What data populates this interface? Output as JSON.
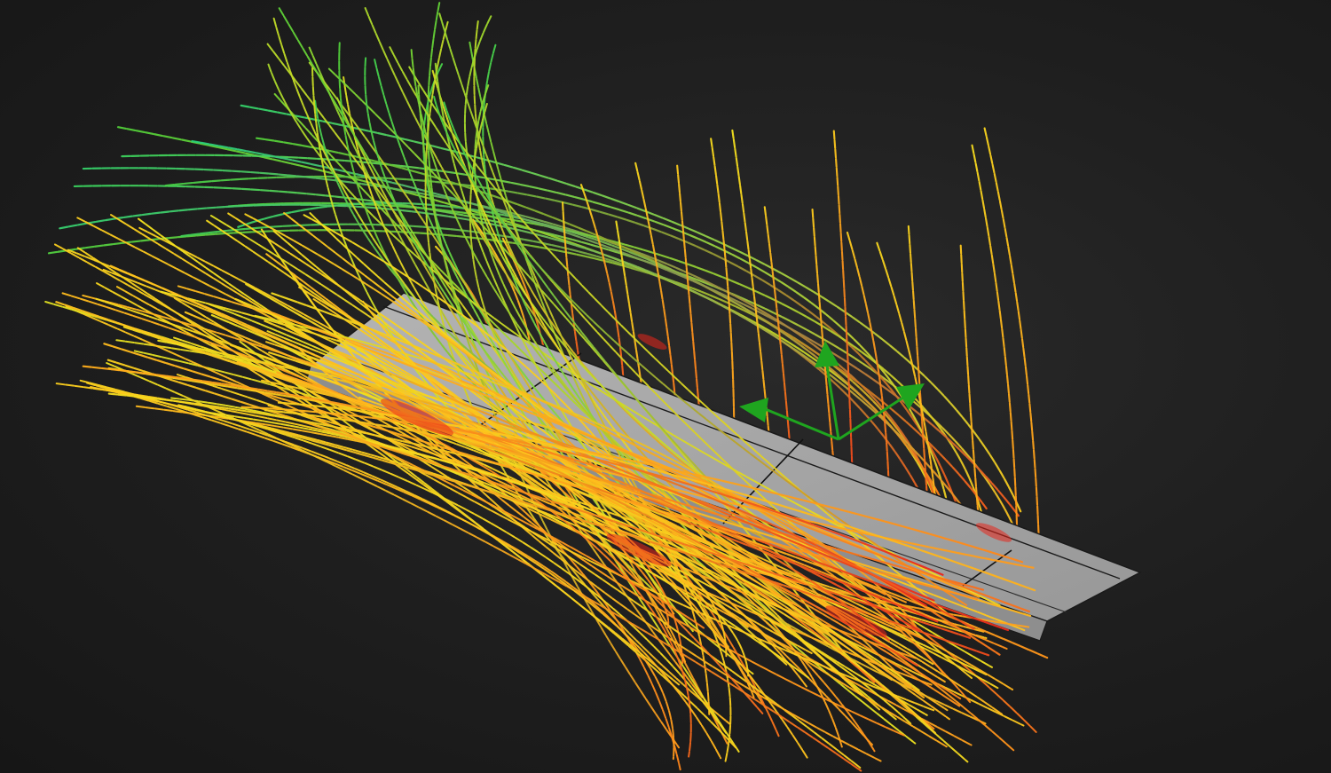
{
  "scene": {
    "background_color": "#1e1e1e",
    "plate_color": "#a8a8a8",
    "plate_edge_color": "#101010",
    "axis_triad_color": "#1fa51f",
    "streamline_color_scale": [
      "#2ad07a",
      "#4ccf3a",
      "#a8d82a",
      "#f2e21e",
      "#ffc31c",
      "#ff8a1a",
      "#e8261c"
    ],
    "streamline_families": {
      "green_arcs": 13,
      "upper_fan": 34,
      "vertical_lines": 19,
      "lower_fan": 65,
      "left_sweep": 22
    },
    "icons": {
      "axis_triad": "axis-triad-icon"
    }
  }
}
